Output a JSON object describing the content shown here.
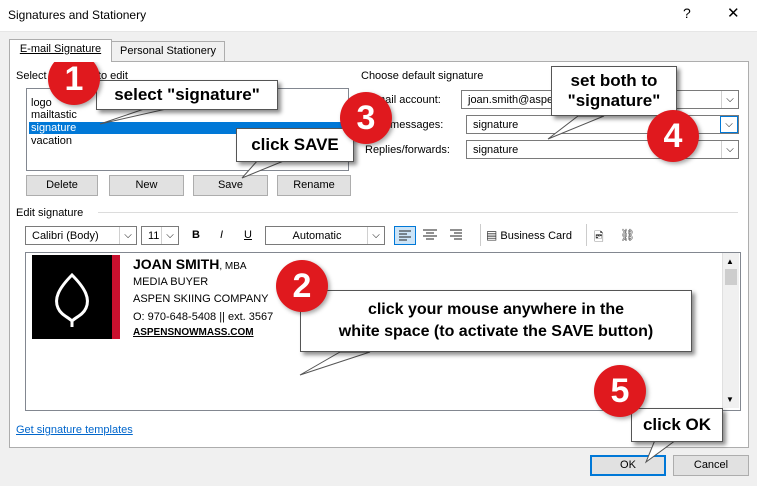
{
  "window": {
    "title": "Signatures and Stationery",
    "help": "?",
    "close": "✕"
  },
  "tabs": [
    {
      "label": "E-mail Signature"
    },
    {
      "label": "Personal Stationery"
    }
  ],
  "select_section": {
    "label": "Select signature to edit"
  },
  "signature_list": {
    "items": [
      "logo",
      "mailtastic",
      "signature",
      "vacation"
    ],
    "selected": "signature"
  },
  "buttons": {
    "delete": "Delete",
    "new": "New",
    "save": "Save",
    "rename": "Rename",
    "ok": "OK",
    "cancel": "Cancel"
  },
  "default_signature": {
    "label": "Choose default signature",
    "email_account_label": "E-mail account:",
    "email_account_value": "joan.smith@aspensnowmass.com",
    "new_messages_label": "New messages:",
    "new_messages_value": "signature",
    "replies_label": "Replies/forwards:",
    "replies_value": "signature"
  },
  "edit_section": {
    "label": "Edit signature"
  },
  "toolbar": {
    "font": "Calibri (Body)",
    "size": "11",
    "bold": "B",
    "italic": "I",
    "underline": "U",
    "color": "Automatic",
    "business_card": "Business Card"
  },
  "signature_content": {
    "name": "JOAN SMITH",
    "credential": ", MBA",
    "title": "MEDIA BUYER",
    "company": "ASPEN SKIING COMPANY",
    "phone": "O: 970-648-5408 || ext. 3567",
    "website": "ASPENSNOWMASS.COM"
  },
  "templates_link": "Get signature templates",
  "annotations": {
    "step1": {
      "number": "1",
      "text": "select \"signature\""
    },
    "step2": {
      "number": "2",
      "text_line1": "click your mouse anywhere in the",
      "text_line2": "white space (to activate the SAVE button)"
    },
    "step3": {
      "number": "3",
      "text": "click SAVE"
    },
    "step4": {
      "number": "4",
      "text_line1": "set both to",
      "text_line2": "\"signature\""
    },
    "step5": {
      "number": "5",
      "text": "click OK"
    }
  },
  "colors": {
    "accent_blue": "#0078d7",
    "badge_red": "#e0191e",
    "logo_black": "#000000",
    "logo_red": "#c8102e"
  }
}
